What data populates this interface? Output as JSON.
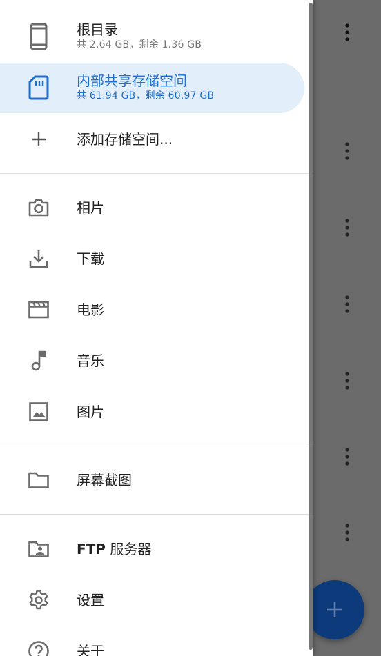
{
  "storage": [
    {
      "title": "根目录",
      "subtitle": "共 2.64 GB，剩余 1.36 GB",
      "icon": "phone-icon"
    },
    {
      "title": "内部共享存储空间",
      "subtitle": "共 61.94 GB，剩余 60.97 GB",
      "icon": "sd-card-icon"
    }
  ],
  "add_storage": {
    "label": "添加存储空间...",
    "icon": "plus-icon"
  },
  "places": [
    {
      "label": "相片",
      "icon": "camera-icon"
    },
    {
      "label": "下载",
      "icon": "download-icon"
    },
    {
      "label": "电影",
      "icon": "movie-icon"
    },
    {
      "label": "音乐",
      "icon": "music-note-icon"
    },
    {
      "label": "图片",
      "icon": "image-icon"
    }
  ],
  "bookmarks": [
    {
      "label": "屏幕截图",
      "icon": "folder-icon"
    }
  ],
  "tools": [
    {
      "label_bold": "FTP",
      "label_rest": " 服务器",
      "icon": "ftp-folder-icon"
    },
    {
      "label": "设置",
      "icon": "gear-icon"
    },
    {
      "label": "关于",
      "icon": "help-icon"
    }
  ],
  "colors": {
    "accent": "#1f6fd1",
    "selected_bg": "#e3eefb",
    "scrim": "#6b6b6b",
    "fab": "#0d3a7a"
  }
}
